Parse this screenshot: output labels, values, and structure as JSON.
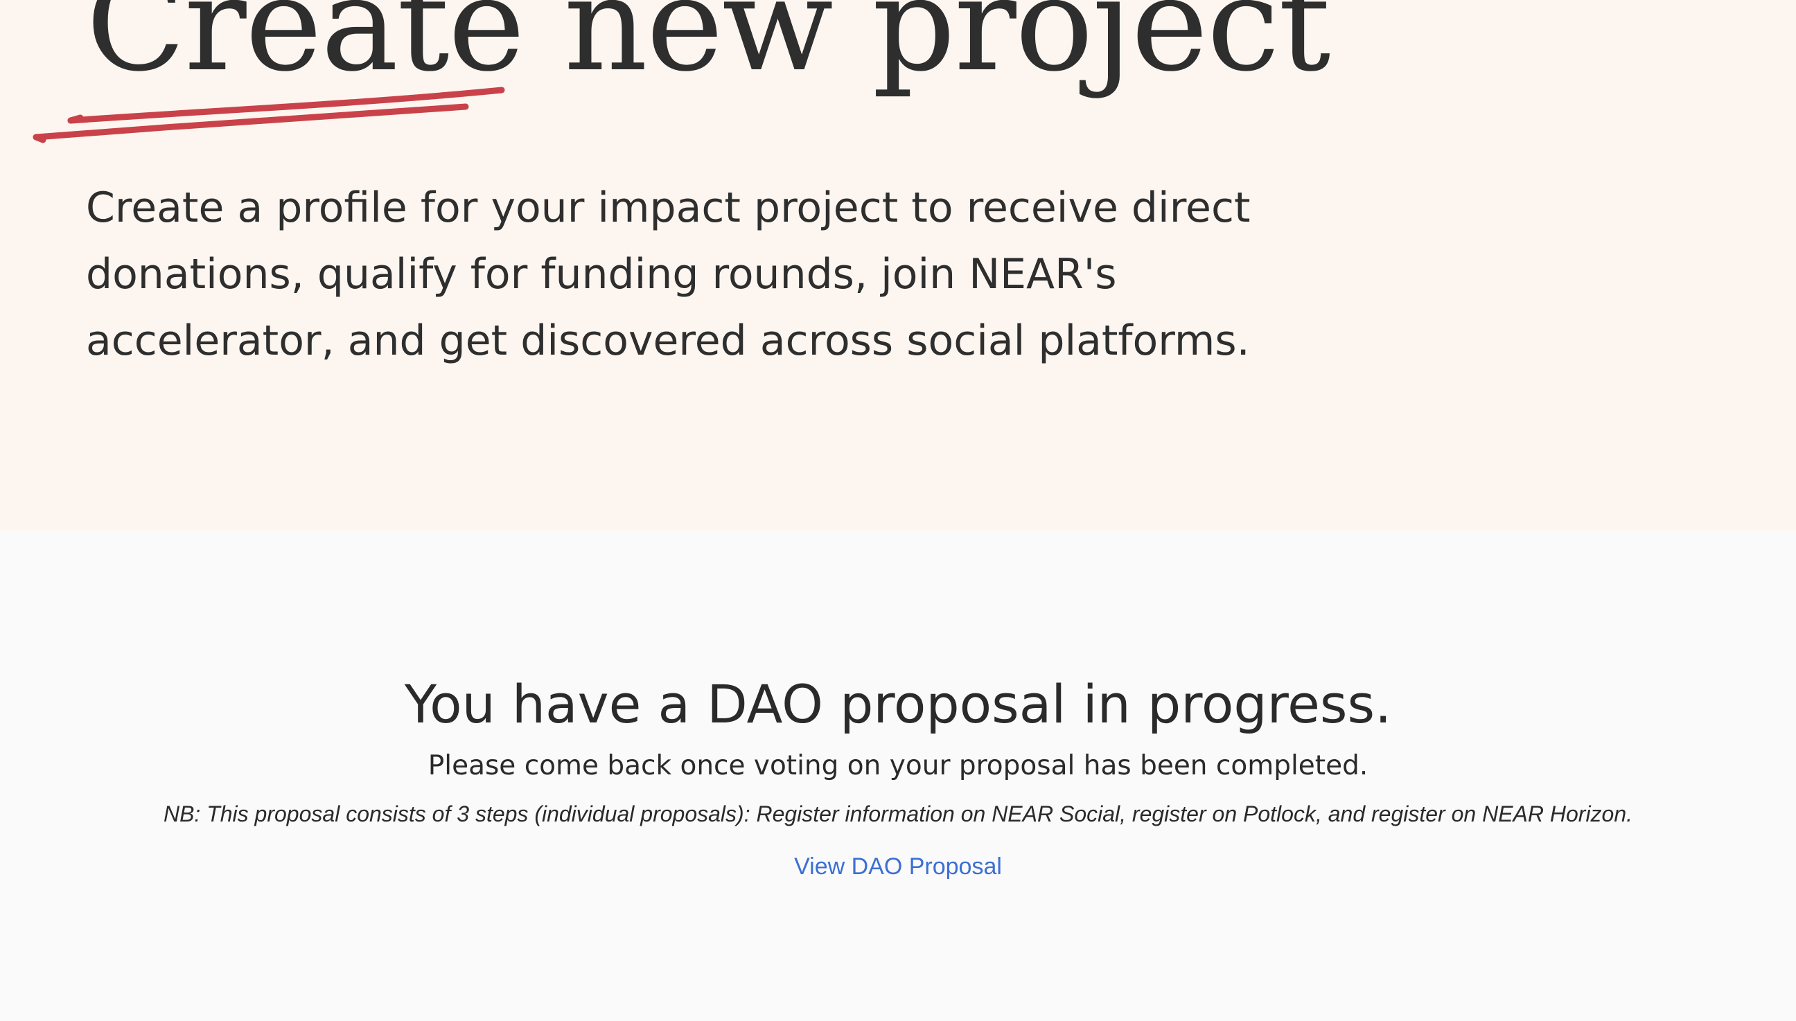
{
  "hero": {
    "title": "Create new project",
    "subtitle": "Create a profile for your impact project to receive direct donations, qualify for funding rounds, join NEAR's accelerator, and get discovered across social platforms.",
    "accent_color": "#c9424a",
    "background": "#fdf6f0"
  },
  "proposal_status": {
    "heading": "You have a DAO proposal in progress.",
    "message": "Please come back once voting on your proposal has been completed.",
    "note": "NB: This proposal consists of 3 steps (individual proposals): Register information on NEAR Social, register on Potlock, and register on NEAR Horizon.",
    "link_label": "View DAO Proposal",
    "link_color": "#3b6fd4",
    "background": "#fafafa"
  }
}
